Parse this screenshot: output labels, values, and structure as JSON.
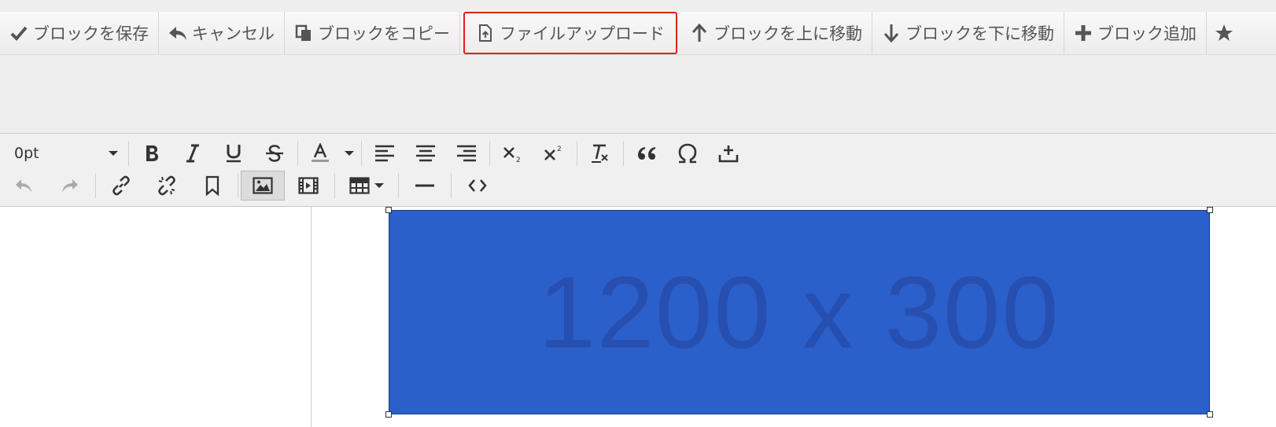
{
  "block_toolbar": {
    "buttons": [
      {
        "label": "ブロックを保存",
        "icon": "check-icon"
      },
      {
        "label": "キャンセル",
        "icon": "reply-icon"
      },
      {
        "label": "ブロックをコピー",
        "icon": "copy-icon"
      },
      {
        "label": "ファイルアップロード",
        "icon": "file-upload-icon"
      },
      {
        "label": "ブロックを上に移動",
        "icon": "arrow-up-icon"
      },
      {
        "label": "ブロックを下に移動",
        "icon": "arrow-down-icon"
      },
      {
        "label": "ブロック追加",
        "icon": "plus-icon"
      }
    ],
    "overflow_icon": "star-icon",
    "highlight_color": "#e02020"
  },
  "format_toolbar": {
    "font_size": "0pt",
    "row1_tools": [
      "bold-icon",
      "italic-icon",
      "underline-icon",
      "strikethrough-icon",
      "text-color-icon",
      "align-left-icon",
      "align-center-icon",
      "align-right-icon",
      "subscript-icon",
      "superscript-icon",
      "clear-format-icon",
      "blockquote-icon",
      "special-char-icon",
      "insert-icon"
    ],
    "row2_tools": [
      "undo-icon",
      "redo-icon",
      "link-icon",
      "unlink-icon",
      "bookmark-icon",
      "image-icon",
      "video-icon",
      "table-icon",
      "horizontal-rule-icon",
      "source-code-icon"
    ],
    "active_tool": "image-icon"
  },
  "content": {
    "placeholder_text": "1200 x 300",
    "placeholder_color": "#2b5fca"
  }
}
